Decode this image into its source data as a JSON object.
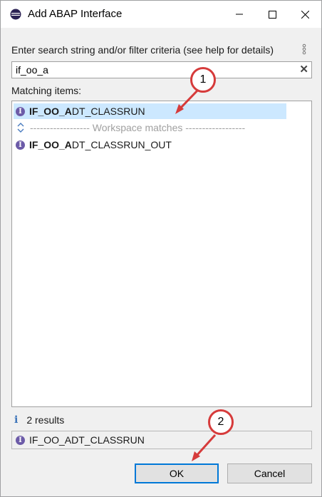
{
  "window": {
    "title": "Add ABAP Interface"
  },
  "search": {
    "prompt": "Enter search string and/or filter criteria (see help for details)",
    "value": "if_oo_a"
  },
  "list": {
    "label": "Matching items:",
    "items": [
      {
        "bold": "IF_OO_A",
        "rest": "DT_CLASSRUN",
        "selected": true
      },
      {
        "bold": "IF_OO_A",
        "rest": "DT_CLASSRUN_OUT",
        "selected": false
      }
    ],
    "separator": "------------------ Workspace matches ------------------"
  },
  "status": {
    "text": "2 results",
    "selected_item": "IF_OO_ADT_CLASSRUN"
  },
  "buttons": {
    "ok": "OK",
    "cancel": "Cancel"
  },
  "callouts": {
    "first": "1",
    "second": "2"
  },
  "colors": {
    "selection": "#cce8ff",
    "callout_border": "#d63b3b",
    "interface_icon": "#6c5ba8"
  }
}
